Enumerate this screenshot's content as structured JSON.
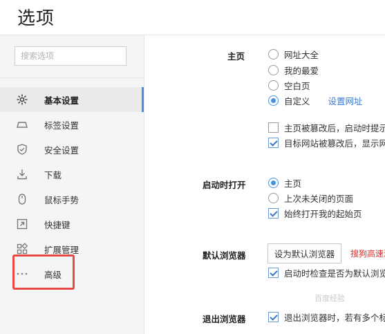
{
  "page": {
    "title": "选项"
  },
  "sidebar": {
    "search_placeholder": "搜索选项",
    "items": [
      {
        "label": "基本设置",
        "icon": "gear-icon",
        "active": true
      },
      {
        "label": "标签设置",
        "icon": "tab-icon",
        "active": false
      },
      {
        "label": "安全设置",
        "icon": "shield-icon",
        "active": false
      },
      {
        "label": "下载",
        "icon": "download-icon",
        "active": false
      },
      {
        "label": "鼠标手势",
        "icon": "mouse-icon",
        "active": false
      },
      {
        "label": "快捷键",
        "icon": "shortcut-icon",
        "active": false
      },
      {
        "label": "扩展管理",
        "icon": "extensions-icon",
        "active": false
      },
      {
        "label": "高级",
        "icon": "more-icon",
        "active": false
      }
    ],
    "highlight_color": "#e84a4a",
    "accent_color": "#4a90e2"
  },
  "homepage": {
    "label": "主页",
    "options": [
      {
        "label": "网址大全",
        "checked": false
      },
      {
        "label": "我的最爱",
        "checked": false
      },
      {
        "label": "空白页",
        "checked": false
      },
      {
        "label": "自定义",
        "checked": true
      }
    ],
    "set_url_link": "设置网址",
    "checks": [
      {
        "label": "主页被篡改后，启动时提示",
        "checked": false
      },
      {
        "label": "目标网站被篡改后，显示网",
        "checked": true
      }
    ]
  },
  "startup": {
    "label": "启动时打开",
    "options": [
      {
        "label": "主页",
        "checked": true
      },
      {
        "label": "上次未关闭的页面",
        "checked": false
      }
    ],
    "always_open": {
      "label": "始终打开我的起始页",
      "checked": true
    }
  },
  "default_browser": {
    "label": "默认浏览器",
    "button": "设为默认浏览器",
    "warning": "搜狗高速浏",
    "check": {
      "label": "启动时检查是否为默认浏览",
      "checked": true
    }
  },
  "exit_browser": {
    "label": "退出浏览器",
    "check": {
      "label": "退出浏览器时，若有多个标",
      "checked": true
    }
  },
  "watermark": "百度经验"
}
